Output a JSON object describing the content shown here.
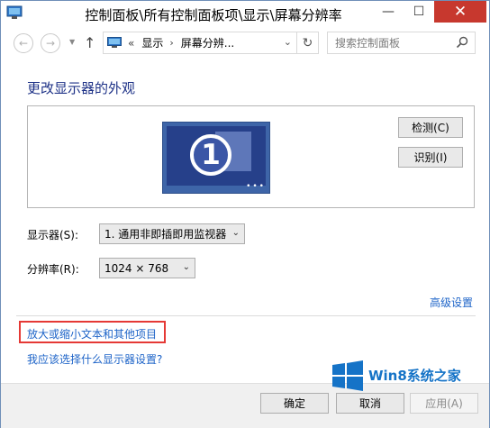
{
  "window": {
    "title": "控制面板\\所有控制面板项\\显示\\屏幕分辨率",
    "close": "✕",
    "maximize": "☐",
    "minimize": "—"
  },
  "nav": {
    "breadcrumb_sep": "«",
    "crumbs": [
      "显示",
      "屏幕分辨..."
    ],
    "search_placeholder": "搜索控制面板"
  },
  "main": {
    "heading": "更改显示器的外观",
    "detect_button": "检测(C)",
    "identify_button": "识别(I)",
    "monitor_number": "1",
    "display_label": "显示器(S):",
    "display_value": "1. 通用非即插即用监视器",
    "resolution_label": "分辨率(R):",
    "resolution_value": "1024 × 768",
    "advanced_link": "高级设置",
    "zoom_link": "放大或缩小文本和其他项目",
    "which_link": "我应该选择什么显示器设置?"
  },
  "footer": {
    "ok": "确定",
    "cancel": "取消",
    "apply": "应用(A)"
  },
  "watermark": {
    "text": "Win8系统之家"
  },
  "colors": {
    "heading": "#1e3287",
    "link": "#1e64c8",
    "close_button": "#c7382e",
    "highlight": "#e53935",
    "monitor": "#3e65a8"
  }
}
